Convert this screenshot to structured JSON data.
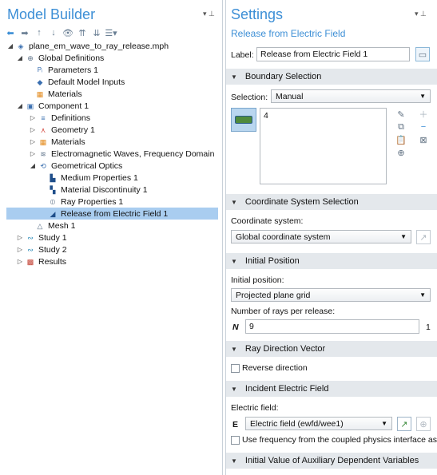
{
  "model_builder": {
    "title": "Model Builder",
    "toolbar": [
      "back-arrow-icon",
      "forward-arrow-icon",
      "up-arrow-icon",
      "down-arrow-icon",
      "show-icon",
      "collapse-icon",
      "expand-icon",
      "menu-icon"
    ],
    "tree": [
      {
        "label": "plane_em_wave_to_ray_release.mph",
        "icon": "model-icon"
      },
      {
        "label": "Global Definitions",
        "icon": "globe-icon"
      },
      {
        "label": "Parameters 1",
        "icon": "parameters-icon"
      },
      {
        "label": "Default Model Inputs",
        "icon": "model-inputs-icon"
      },
      {
        "label": "Materials",
        "icon": "materials-icon"
      },
      {
        "label": "Component 1",
        "icon": "component-icon"
      },
      {
        "label": "Definitions",
        "icon": "definitions-icon"
      },
      {
        "label": "Geometry 1",
        "icon": "geometry-icon"
      },
      {
        "label": "Materials",
        "icon": "materials-icon"
      },
      {
        "label": "Electromagnetic Waves, Frequency Domain",
        "icon": "em-waves-icon"
      },
      {
        "label": "Geometrical Optics",
        "icon": "geometrical-optics-icon"
      },
      {
        "label": "Medium Properties 1",
        "icon": "medium-properties-icon"
      },
      {
        "label": "Material Discontinuity 1",
        "icon": "material-discontinuity-icon"
      },
      {
        "label": "Ray Properties 1",
        "icon": "ray-properties-icon"
      },
      {
        "label": "Release from Electric Field 1",
        "icon": "release-icon"
      },
      {
        "label": "Mesh 1",
        "icon": "mesh-icon"
      },
      {
        "label": "Study 1",
        "icon": "study-icon"
      },
      {
        "label": "Study 2",
        "icon": "study-icon"
      },
      {
        "label": "Results",
        "icon": "results-icon"
      }
    ]
  },
  "settings": {
    "title": "Settings",
    "subtitle": "Release from Electric Field",
    "label_caption": "Label:",
    "label_value": "Release from Electric Field 1",
    "boundary_selection": {
      "header": "Boundary Selection",
      "selection_caption": "Selection:",
      "selection_value": "Manual",
      "list_value": "4"
    },
    "coordinate_system": {
      "header": "Coordinate System Selection",
      "caption": "Coordinate system:",
      "value": "Global coordinate system"
    },
    "initial_position": {
      "header": "Initial Position",
      "caption": "Initial position:",
      "value": "Projected plane grid",
      "rays_caption": "Number of rays per release:",
      "symbol": "N",
      "rays_value": "9",
      "unit": "1"
    },
    "ray_direction": {
      "header": "Ray Direction Vector",
      "reverse_label": "Reverse direction"
    },
    "incident_field": {
      "header": "Incident Electric Field",
      "caption": "Electric field:",
      "symbol": "E",
      "value": "Electric field (ewfd/wee1)",
      "use_frequency_label": "Use frequency from the coupled physics interface as th"
    },
    "aux_vars": {
      "header": "Initial Value of Auxiliary Dependent Variables"
    }
  }
}
